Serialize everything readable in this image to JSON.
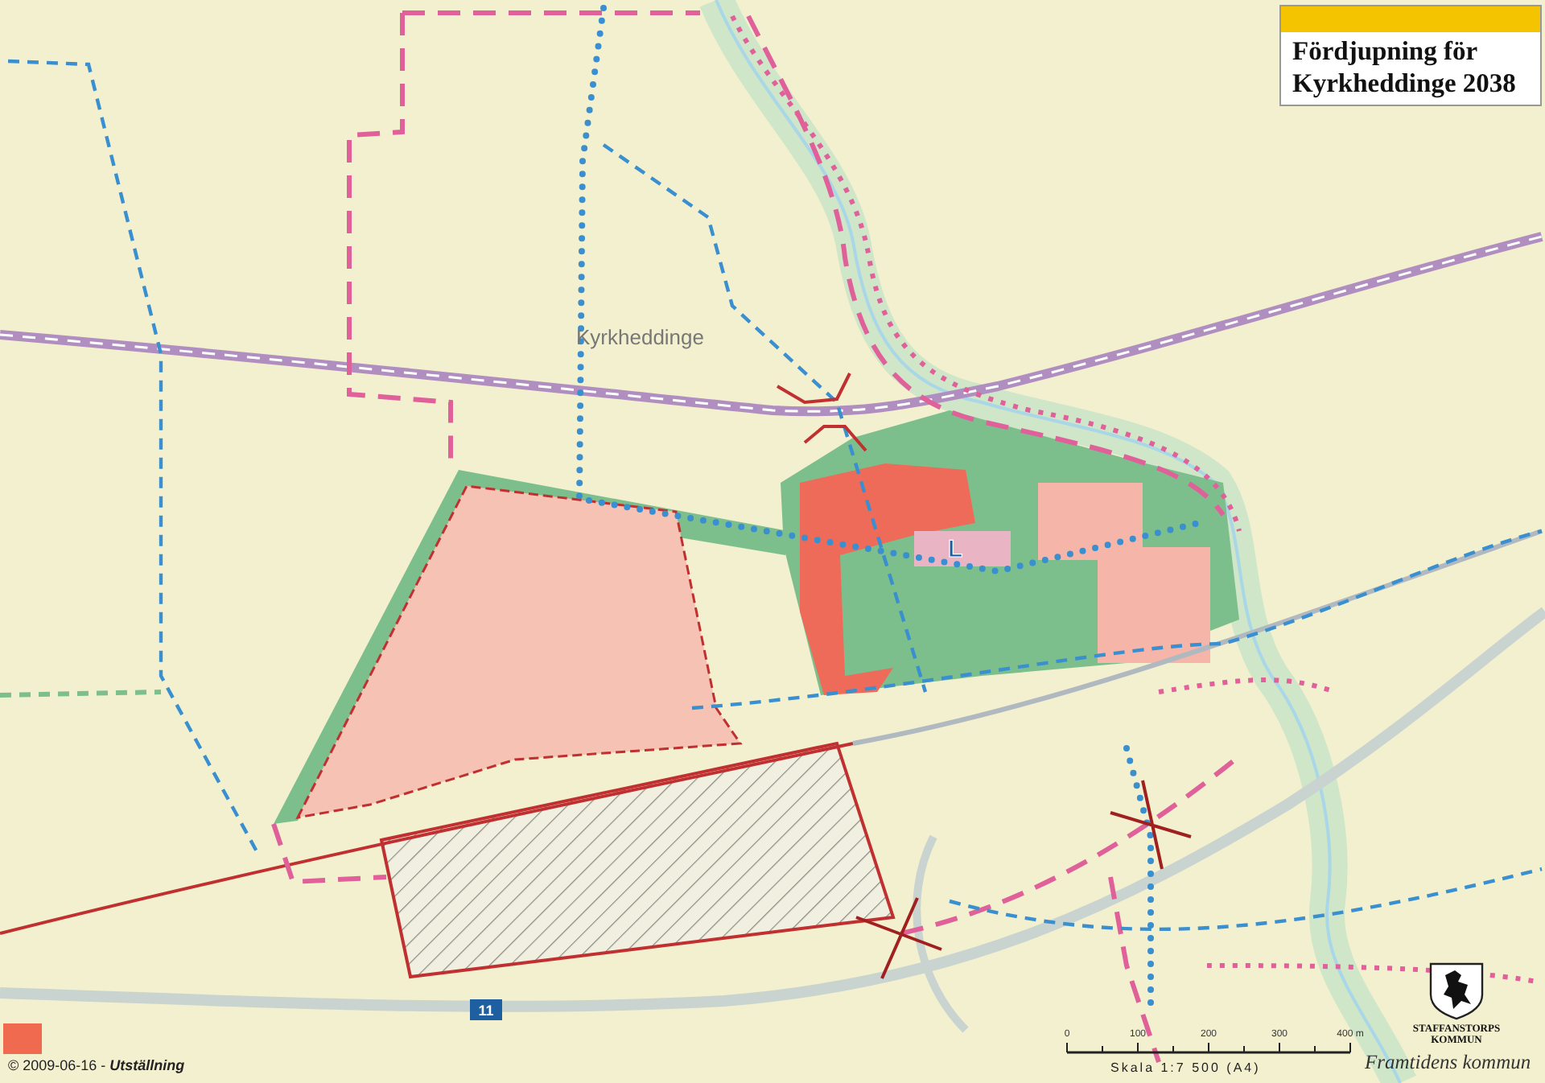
{
  "title": {
    "lines": [
      "Fördjupning för",
      "Kyrkheddinge 2038"
    ]
  },
  "map": {
    "place_label": "Kyrkheddinge",
    "road_number": "11",
    "zone_marker": "L"
  },
  "scale": {
    "ticks": [
      "0",
      "100",
      "200",
      "300",
      "400 m"
    ],
    "caption": "Skala 1:7 500 (A4)"
  },
  "logo": {
    "name": "STAFFANSTORPS KOMMUN",
    "tagline": "Framtidens kommun"
  },
  "footer": {
    "text": "© 2009-06-16 - **Utställning**"
  }
}
